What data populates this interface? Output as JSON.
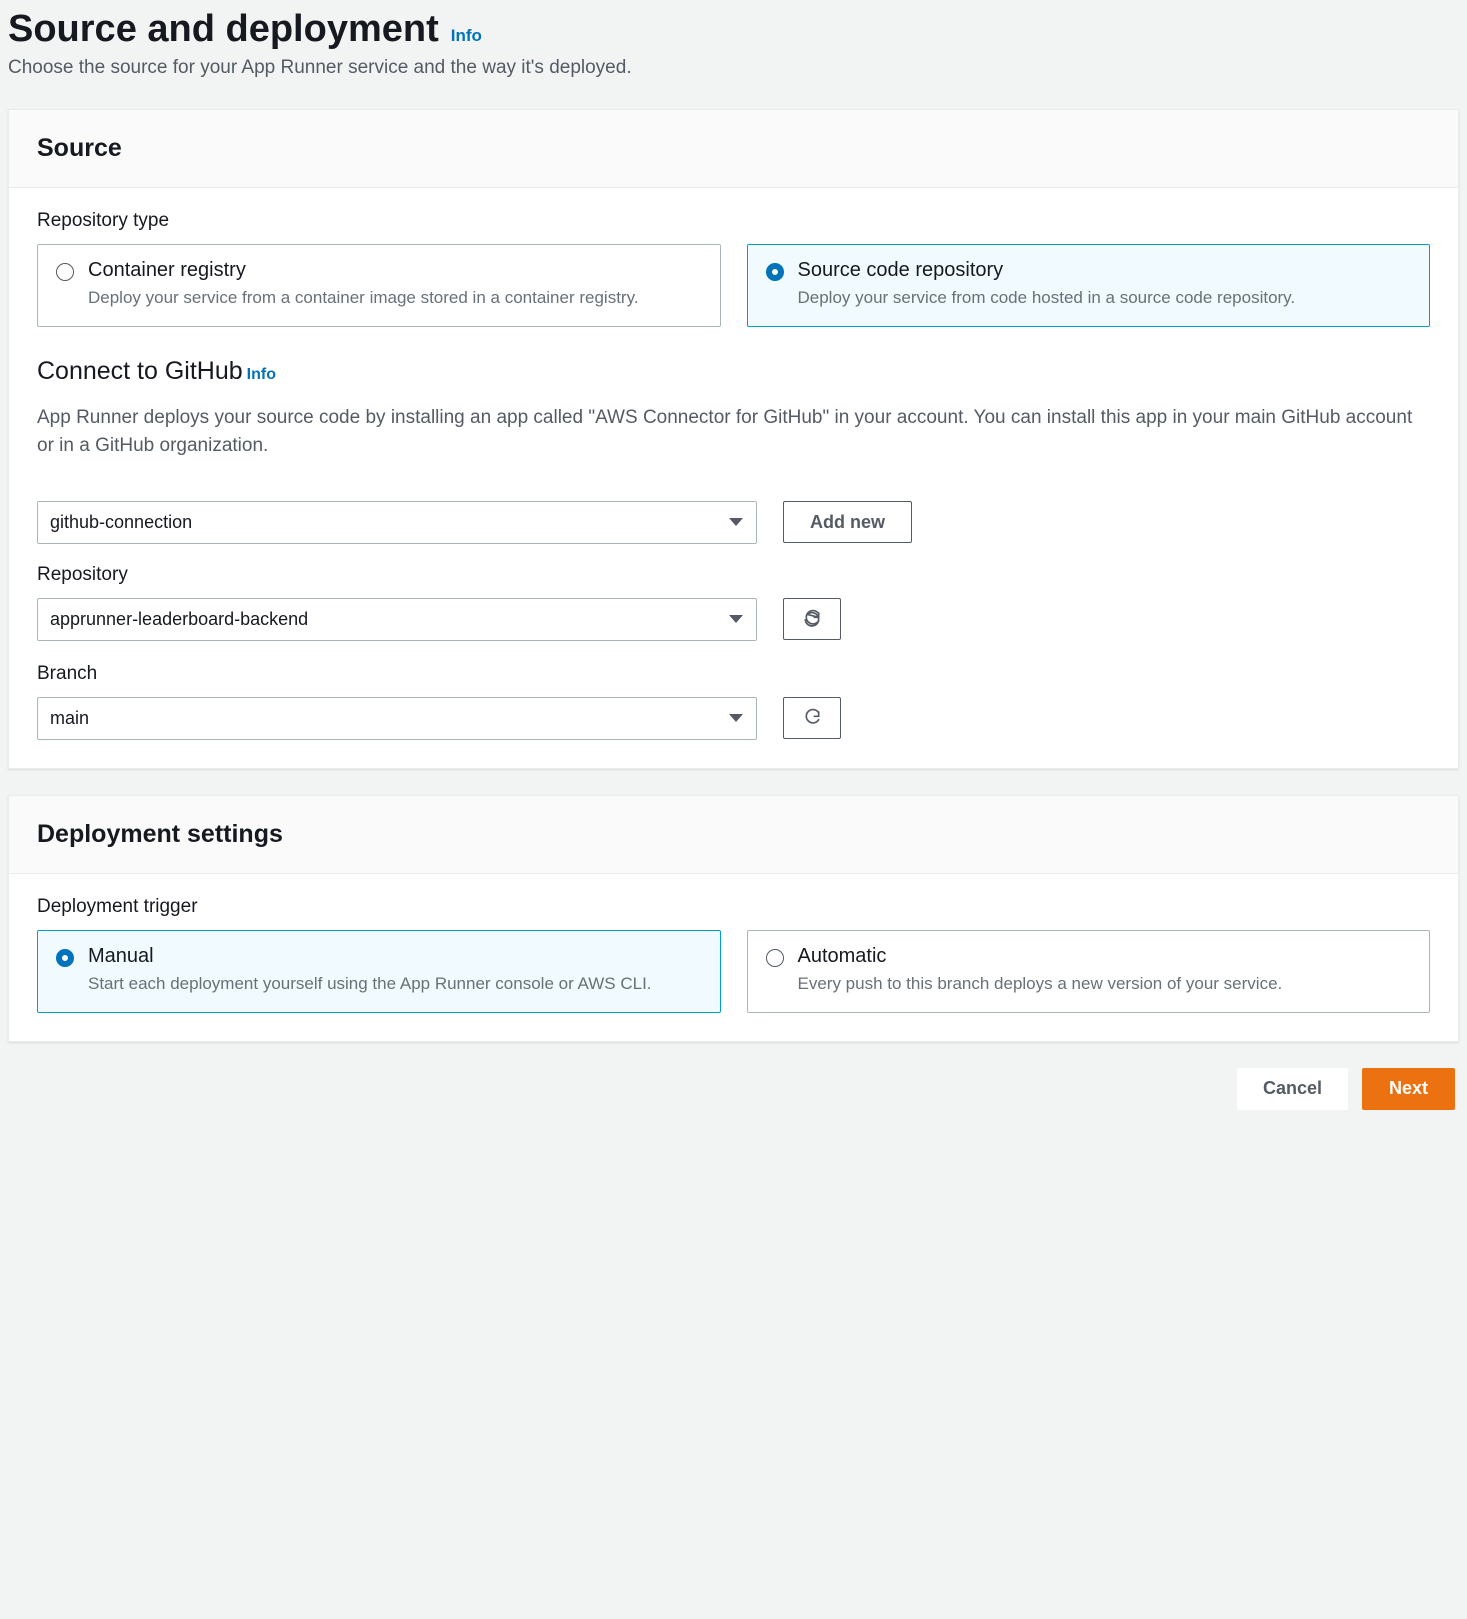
{
  "page": {
    "title": "Source and deployment",
    "info_label": "Info",
    "subtitle": "Choose the source for your App Runner service and the way it's deployed."
  },
  "source_panel": {
    "heading": "Source",
    "repo_type_label": "Repository type",
    "tiles": {
      "container": {
        "title": "Container registry",
        "desc": "Deploy your service from a container image stored in a container registry."
      },
      "source_code": {
        "title": "Source code repository",
        "desc": "Deploy your service from code hosted in a source code repository."
      }
    },
    "connect": {
      "title": "Connect to GitHub",
      "info_label": "Info",
      "desc": "App Runner deploys your source code by installing an app called \"AWS Connector for GitHub\" in your account. You can install this app in your main GitHub account or in a GitHub organization."
    },
    "connection_select": "github-connection",
    "add_new_label": "Add new",
    "repository_label": "Repository",
    "repository_value": "apprunner-leaderboard-backend",
    "branch_label": "Branch",
    "branch_value": "main"
  },
  "deployment_panel": {
    "heading": "Deployment settings",
    "trigger_label": "Deployment trigger",
    "tiles": {
      "manual": {
        "title": "Manual",
        "desc": "Start each deployment yourself using the App Runner console or AWS CLI."
      },
      "automatic": {
        "title": "Automatic",
        "desc": "Every push to this branch deploys a new version of your service."
      }
    }
  },
  "footer": {
    "cancel": "Cancel",
    "next": "Next"
  }
}
